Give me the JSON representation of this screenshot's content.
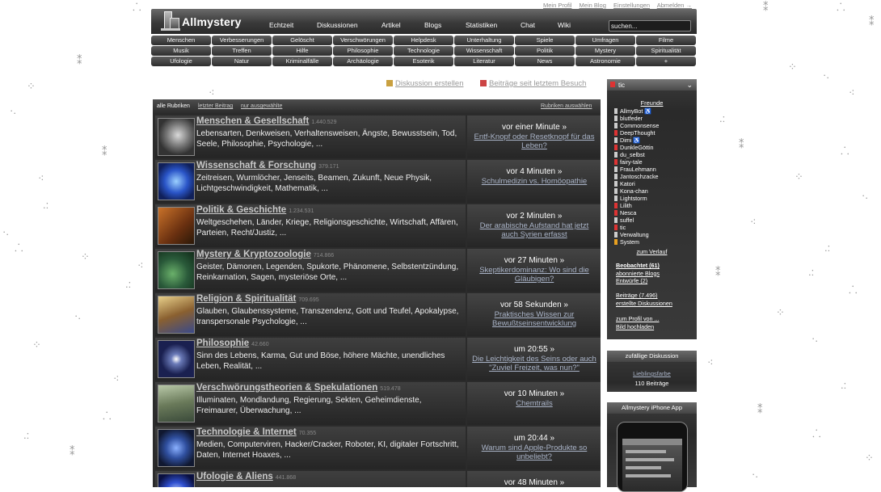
{
  "toplinks": [
    "Mein Profil",
    "Mein Blog",
    "Einstellungen",
    "Abmelden →"
  ],
  "site": {
    "name": "Allmystery"
  },
  "mainnav": [
    "Echtzeit",
    "Diskussionen",
    "Artikel",
    "Blogs",
    "Statistiken",
    "Chat",
    "Wiki"
  ],
  "search": {
    "value": "suchen..."
  },
  "categories": [
    [
      "Menschen",
      "Verbesserungen",
      "Gelöscht",
      "Verschwörungen",
      "Helpdesk",
      "Unterhaltung",
      "Spiele",
      "Umfragen",
      "Filme"
    ],
    [
      "Musik",
      "Treffen",
      "Hilfe",
      "Philosophie",
      "Technologie",
      "Wissenschaft",
      "Politik",
      "Mystery",
      "Spiritualität"
    ],
    [
      "Ufologie",
      "Natur",
      "Kriminalfälle",
      "Archäologie",
      "Esoterik",
      "Literatur",
      "News",
      "Astronomie",
      "+"
    ]
  ],
  "actions": {
    "create": "Diskussion erstellen",
    "since": "Beiträge seit letztem Besuch"
  },
  "forumbar": {
    "all": "alle Rubriken",
    "last": "letzter Beitrag",
    "selected": "nur ausgewählte",
    "choose": "Rubriken auswählen"
  },
  "forums": [
    {
      "title": "Menschen & Gesellschaft",
      "count": "1.440.529",
      "desc": "Lebensarten, Denkweisen, Verhaltensweisen, Ängste, Bewusstsein, Tod, Seele, Philosophie, Psychologie, ...",
      "time": "vor einer Minute »",
      "last": "Entf-Knopf oder Resetknopf für das Leben?"
    },
    {
      "title": "Wissenschaft & Forschung",
      "count": "379.171",
      "desc": "Zeitreisen, Wurmlöcher, Jenseits, Beamen, Zukunft, Neue Physik, Lichtgeschwindigkeit, Mathematik, ...",
      "time": "vor 4 Minuten »",
      "last": "Schulmedizin vs. Homöopathie"
    },
    {
      "title": "Politik & Geschichte",
      "count": "1.234.531",
      "desc": "Weltgeschehen, Länder, Kriege, Religionsgeschichte, Wirtschaft, Affären, Parteien, Recht/Justiz, ...",
      "time": "vor 2 Minuten »",
      "last": "Der arabische Aufstand hat jetzt auch Syrien erfasst"
    },
    {
      "title": "Mystery & Kryptozoologie",
      "count": "714.866",
      "desc": "Geister, Dämonen, Legenden, Spukorte, Phänomene, Selbstentzündung, Reinkarnation, Sagen, mysteriöse Orte, ...",
      "time": "vor 27 Minuten »",
      "last": "Skeptikerdominanz: Wo sind die Gläubigen?"
    },
    {
      "title": "Religion & Spiritualität",
      "count": "709.695",
      "desc": "Glauben, Glaubenssysteme, Transzendenz, Gott und Teufel, Apokalypse, transpersonale Psychologie, ...",
      "time": "vor 58 Sekunden »",
      "last": "Praktisches Wissen zur Bewußtseinsentwicklung"
    },
    {
      "title": "Philosophie",
      "count": "42.660",
      "desc": "Sinn des Lebens, Karma, Gut und Böse, höhere Mächte, unendliches Leben, Realität, ...",
      "time": "um 20:55 »",
      "last": "Die Leichtigkeit des Seins oder auch \"Zuviel Freizeit, was nun?\""
    },
    {
      "title": "Verschwörungstheorien & Spekulationen",
      "count": "519.478",
      "desc": "Illuminaten, Mondlandung, Regierung, Sekten, Geheimdienste, Freimaurer, Überwachung, ...",
      "time": "vor 10 Minuten »",
      "last": "Chemtrails"
    },
    {
      "title": "Technologie & Internet",
      "count": "70.355",
      "desc": "Medien, Computerviren, Hacker/Cracker, Roboter, KI, digitaler Fortschritt, Daten, Internet Hoaxes, ...",
      "time": "um 20:44 »",
      "last": "Warum sind Apple-Produkte so unbeliebt?"
    },
    {
      "title": "Ufologie & Aliens",
      "count": "441.868",
      "desc": "",
      "time": "vor 48 Minuten »",
      "last": ""
    }
  ],
  "user": {
    "name": "tic",
    "friends_label": "Freunde",
    "friends": [
      {
        "name": "AllmyBot ♿",
        "status": "on"
      },
      {
        "name": "blutfeder",
        "status": "on"
      },
      {
        "name": "Commonsense",
        "status": "on"
      },
      {
        "name": "DeepThought",
        "status": "off"
      },
      {
        "name": "Dimi ♿",
        "status": "on"
      },
      {
        "name": "DunkleGöttin",
        "status": "off"
      },
      {
        "name": "du_selbst",
        "status": "on"
      },
      {
        "name": "fairy-tale",
        "status": "off"
      },
      {
        "name": "FrauLehmann",
        "status": "on"
      },
      {
        "name": "Jantoschzacke",
        "status": "on"
      },
      {
        "name": "Katori",
        "status": "on"
      },
      {
        "name": "Kona-chan",
        "status": "on"
      },
      {
        "name": "Lightstorm",
        "status": "on"
      },
      {
        "name": "Lilith",
        "status": "off"
      },
      {
        "name": "Nesca",
        "status": "off"
      },
      {
        "name": "suffel",
        "status": "on"
      },
      {
        "name": "tic",
        "status": "off"
      },
      {
        "name": "Verwaltung",
        "status": "on"
      },
      {
        "name": "System",
        "status": "sys"
      }
    ],
    "history": "zum Verlauf",
    "links1": [
      "Beobachtet (61)",
      "abonnierte Blogs",
      "Entwürfe (2)"
    ],
    "links2": [
      "Beiträge (7.496)",
      "erstellte Diskussionen"
    ],
    "links3": [
      "zum Profil von ...",
      "Bild hochladen"
    ]
  },
  "random": {
    "head": "zufällige Diskussion",
    "title": "Lieblingsfarbe",
    "count": "110 Beiträge"
  },
  "app": {
    "head": "Allmystery iPhone App"
  },
  "colors": {
    "accent": "#aab4c8",
    "panel": "#2b2b2b",
    "offline": "#dd3333"
  }
}
